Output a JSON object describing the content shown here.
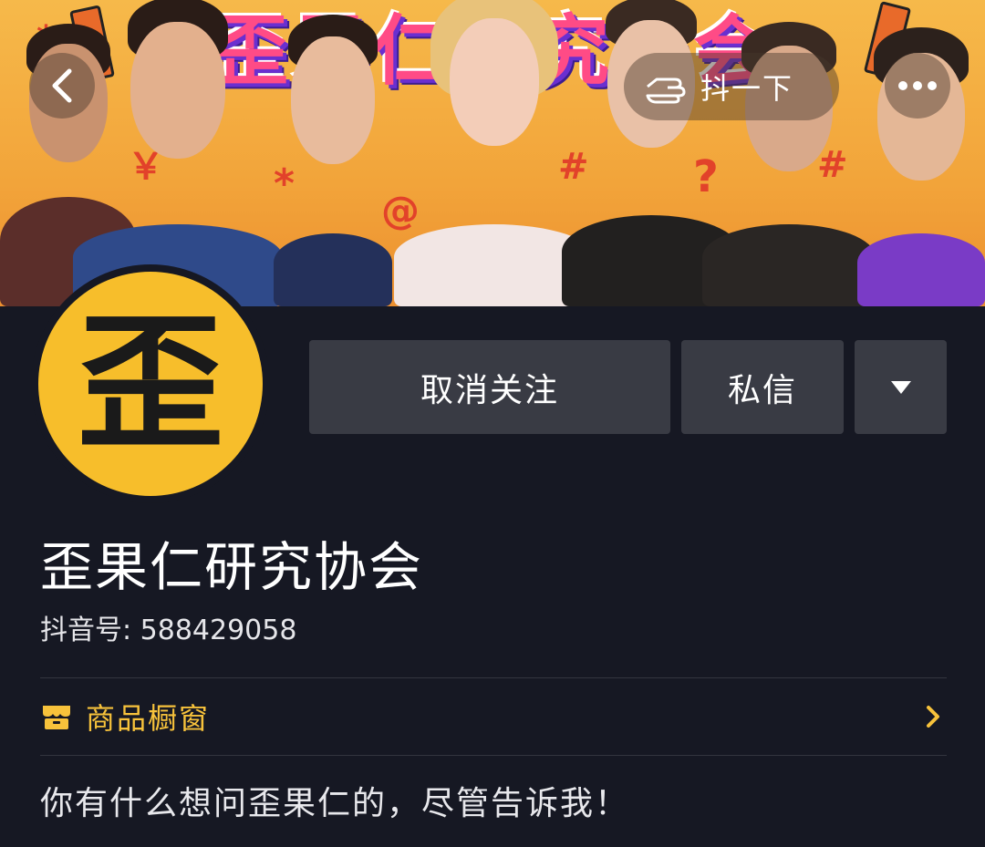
{
  "banner": {
    "title": "歪果仁研究协会",
    "decorations": [
      "￥",
      "*",
      "@",
      "#",
      "?",
      "#",
      "*"
    ]
  },
  "nav": {
    "back_icon": "chevron-left-icon",
    "shake_label": "抖一下",
    "shake_icon": "hand-icon",
    "more_icon": "ellipsis-icon"
  },
  "profile": {
    "avatar_char": "歪",
    "name": "歪果仁研究协会",
    "id_label": "抖音号: 588429058",
    "bio": "你有什么想问歪果仁的，尽管告诉我！"
  },
  "actions": {
    "unfollow_label": "取消关注",
    "message_label": "私信",
    "more_icon": "caret-down-icon"
  },
  "shop": {
    "label": "商品橱窗",
    "icon": "storefront-icon",
    "chevron": "chevron-right-icon"
  },
  "colors": {
    "background": "#161823",
    "button": "#393b44",
    "accent_yellow": "#f7c23b",
    "avatar_yellow": "#f7be2b"
  }
}
